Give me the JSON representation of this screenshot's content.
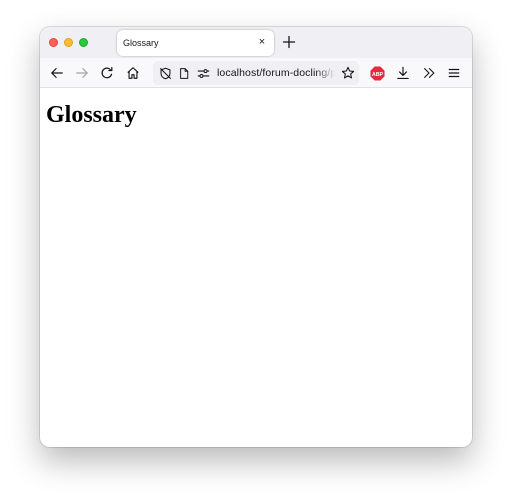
{
  "browser": {
    "tab": {
      "title": "Glossary"
    },
    "url": {
      "text": "localhost/forum-docling/p"
    },
    "extensions": {
      "abp_badge": "ABP"
    }
  },
  "page": {
    "heading": "Glossary"
  },
  "icons": {
    "tab_close": "×",
    "new_tab": "plus-icon",
    "back": "arrow-left-icon",
    "forward": "arrow-right-icon",
    "reload": "reload-icon",
    "home": "home-icon",
    "tracking": "shield-slash-icon",
    "page": "document-icon",
    "permissions": "sliders-icon",
    "bookmark": "star-icon",
    "downloads": "download-icon",
    "overflow": "double-chevron-icon",
    "menu": "hamburger-menu-icon"
  },
  "colors": {
    "close": "#ff5f57",
    "minimize": "#febc2e",
    "maximize": "#28c840",
    "abp_red": "#e8283e"
  }
}
